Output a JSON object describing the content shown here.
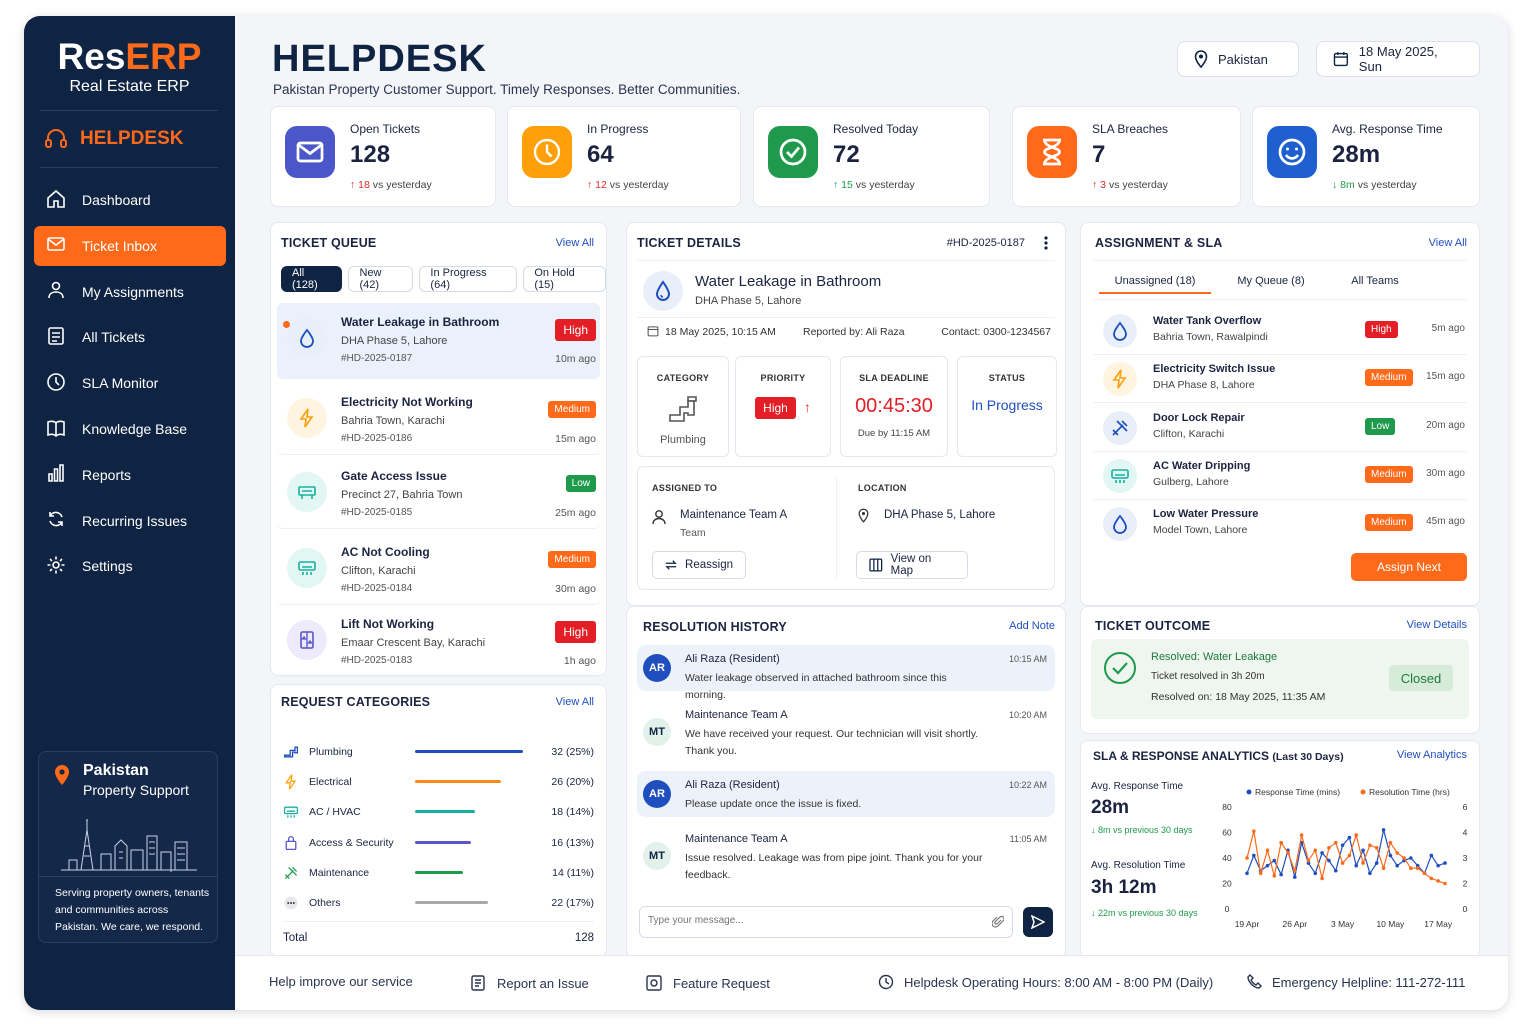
{
  "brand": {
    "name_a": "Res",
    "name_b": "ERP",
    "tagline": "Real Estate ERP"
  },
  "sidebar": {
    "section": "HELPDESK",
    "items": [
      {
        "label": "Dashboard",
        "icon": "home-icon"
      },
      {
        "label": "Ticket Inbox",
        "icon": "inbox-icon"
      },
      {
        "label": "My Assignments",
        "icon": "user-icon"
      },
      {
        "label": "All Tickets",
        "icon": "tickets-icon"
      },
      {
        "label": "SLA Monitor",
        "icon": "clock-icon"
      },
      {
        "label": "Knowledge Base",
        "icon": "book-icon"
      },
      {
        "label": "Reports",
        "icon": "bar-chart-icon"
      },
      {
        "label": "Recurring Issues",
        "icon": "refresh-icon"
      },
      {
        "label": "Settings",
        "icon": "gear-icon"
      }
    ],
    "active_index": 1,
    "promo": {
      "title": "Pakistan",
      "subtitle": "Property Support",
      "desc": "Serving property owners, tenants and communities across Pakistan. We care, we respond."
    }
  },
  "header": {
    "title": "HELPDESK",
    "subtitle": "Pakistan Property Customer Support. Timely Responses. Better Communities.",
    "location": "Pakistan",
    "date": "18 May 2025, Sun"
  },
  "stats": [
    {
      "label": "Open Tickets",
      "value": "128",
      "delta": "18",
      "suffix": "vs yesterday",
      "dir": "up",
      "color": "#4b57c9",
      "icon": "mail-icon"
    },
    {
      "label": "In Progress",
      "value": "64",
      "delta": "12",
      "suffix": "vs yesterday",
      "dir": "up",
      "color": "#ff9f0a",
      "icon": "clock-icon"
    },
    {
      "label": "Resolved Today",
      "value": "72",
      "delta": "15",
      "suffix": "vs yesterday",
      "dir": "up-green",
      "color": "#1f9a4d",
      "icon": "check-icon"
    },
    {
      "label": "SLA Breaches",
      "value": "7",
      "delta": "3",
      "suffix": "vs yesterday",
      "dir": "up",
      "color": "#ff6a1a",
      "icon": "hourglass-icon"
    },
    {
      "label": "Avg. Response Time",
      "value": "28m",
      "delta": "8m",
      "suffix": "vs yesterday",
      "dir": "down",
      "color": "#1f5fd0",
      "icon": "smile-icon"
    }
  ],
  "queue": {
    "title": "TICKET QUEUE",
    "view_all": "View All",
    "tabs": [
      "All (128)",
      "New (42)",
      "In Progress (64)",
      "On Hold (15)"
    ],
    "items": [
      {
        "name": "Water Leakage in Bathroom",
        "loc": "DHA Phase 5, Lahore",
        "id": "#HD-2025-0187",
        "priority": "High",
        "time": "10m ago",
        "icon": "water-drop-icon"
      },
      {
        "name": "Electricity Not Working",
        "loc": "Bahria Town, Karachi",
        "id": "#HD-2025-0186",
        "priority": "Medium",
        "time": "15m ago",
        "icon": "lightning-icon"
      },
      {
        "name": "Gate Access Issue",
        "loc": "Precinct 27, Bahria Town",
        "id": "#HD-2025-0185",
        "priority": "Low",
        "time": "25m ago",
        "icon": "gate-icon"
      },
      {
        "name": "AC Not Cooling",
        "loc": "Clifton, Karachi",
        "id": "#HD-2025-0184",
        "priority": "Medium",
        "time": "30m ago",
        "icon": "ac-icon"
      },
      {
        "name": "Lift Not Working",
        "loc": "Emaar Crescent Bay, Karachi",
        "id": "#HD-2025-0183",
        "priority": "High",
        "time": "1h ago",
        "icon": "lift-icon"
      }
    ]
  },
  "categories": {
    "title": "REQUEST CATEGORIES",
    "view_all": "View All",
    "items": [
      {
        "name": "Plumbing",
        "value": "32 (25%)",
        "fraction": 0.25,
        "color": "#1f4fbf",
        "icon": "pipe-icon"
      },
      {
        "name": "Electrical",
        "value": "26 (20%)",
        "fraction": 0.2,
        "color": "#ff8a1a",
        "icon": "lightning-icon"
      },
      {
        "name": "AC / HVAC",
        "value": "18 (14%)",
        "fraction": 0.14,
        "color": "#17b0a0",
        "icon": "ac-icon"
      },
      {
        "name": "Access & Security",
        "value": "16 (13%)",
        "fraction": 0.13,
        "color": "#5a55c8",
        "icon": "lock-icon"
      },
      {
        "name": "Maintenance",
        "value": "14 (11%)",
        "fraction": 0.11,
        "color": "#1f9a4d",
        "icon": "tools-icon"
      },
      {
        "name": "Others",
        "value": "22 (17%)",
        "fraction": 0.17,
        "color": "#aaaaaa",
        "icon": "more-icon"
      }
    ],
    "total_label": "Total",
    "total_value": "128"
  },
  "details": {
    "title": "TICKET DETAILS",
    "id": "#HD-2025-0187",
    "name": "Water Leakage in Bathroom",
    "loc": "DHA Phase 5, Lahore",
    "date": "18 May 2025, 10:15 AM",
    "reported": "Reported by: Ali Raza",
    "contact": "Contact: 0300-1234567",
    "category_label": "CATEGORY",
    "category": "Plumbing",
    "priority_label": "PRIORITY",
    "priority": "High",
    "sla_label": "SLA DEADLINE",
    "sla": "00:45:30",
    "due": "Due by 11:15 AM",
    "status_label": "STATUS",
    "status": "In Progress",
    "assigned_label": "ASSIGNED TO",
    "assigned": "Maintenance Team A",
    "assigned_sub": "Team",
    "location_label": "LOCATION",
    "location": "DHA Phase 5, Lahore",
    "reassign": "Reassign",
    "view_map": "View on Map"
  },
  "history": {
    "title": "RESOLUTION HISTORY",
    "add": "Add Note",
    "placeholder": "Type your message...",
    "items": [
      {
        "av": "AR",
        "who": "Ali Raza (Resident)",
        "msg": "Water leakage observed in attached bathroom since this morning.",
        "time": "10:15 AM"
      },
      {
        "av": "MT",
        "who": "Maintenance Team A",
        "msg": "We have received your request. Our technician will visit shortly. Thank you.",
        "time": "10:20 AM"
      },
      {
        "av": "AR",
        "who": "Ali Raza (Resident)",
        "msg": "Please update once the issue is fixed.",
        "time": "10:22 AM"
      },
      {
        "av": "MT",
        "who": "Maintenance Team A",
        "msg": "Issue resolved. Leakage was from pipe joint. Thank you for your feedback.",
        "time": "11:05 AM"
      }
    ]
  },
  "assignment": {
    "title": "ASSIGNMENT & SLA",
    "view_all": "View All",
    "tabs": [
      "Unassigned (18)",
      "My Queue (8)",
      "All Teams"
    ],
    "items": [
      {
        "name": "Water Tank Overflow",
        "loc": "Bahria Town, Rawalpindi",
        "priority": "High",
        "time": "5m ago",
        "icon": "water-drop-icon"
      },
      {
        "name": "Electricity Switch Issue",
        "loc": "DHA Phase 8, Lahore",
        "priority": "Medium",
        "time": "15m ago",
        "icon": "lightning-icon"
      },
      {
        "name": "Door Lock Repair",
        "loc": "Clifton, Karachi",
        "priority": "Low",
        "time": "20m ago",
        "icon": "tools-icon"
      },
      {
        "name": "AC Water Dripping",
        "loc": "Gulberg, Lahore",
        "priority": "Medium",
        "time": "30m ago",
        "icon": "ac-icon"
      },
      {
        "name": "Low Water Pressure",
        "loc": "Model Town, Lahore",
        "priority": "Medium",
        "time": "45m ago",
        "icon": "water-drop-icon"
      }
    ],
    "assign_next": "Assign Next"
  },
  "outcome": {
    "title": "TICKET OUTCOME",
    "view": "View Details",
    "headline": "Resolved: Water Leakage",
    "line1": "Ticket resolved in 3h 20m",
    "line2": "Resolved on: 18 May 2025, 11:35 AM",
    "status": "Closed"
  },
  "analytics": {
    "title": "SLA & RESPONSE ANALYTICS",
    "period": "(Last 30 Days)",
    "view": "View Analytics",
    "resp_label": "Avg. Response Time",
    "resp_value": "28m",
    "resp_change": "8m vs previous 30 days",
    "res_label": "Avg. Resolution Time",
    "res_value": "3h 12m",
    "res_change": "22m vs previous 30 days"
  },
  "chart_data": {
    "type": "line",
    "x": [
      "19 Apr",
      "20 Apr",
      "21 Apr",
      "22 Apr",
      "23 Apr",
      "24 Apr",
      "25 Apr",
      "26 Apr",
      "27 Apr",
      "28 Apr",
      "29 Apr",
      "30 Apr",
      "1 May",
      "2 May",
      "3 May",
      "4 May",
      "5 May",
      "6 May",
      "7 May",
      "8 May",
      "9 May",
      "10 May",
      "11 May",
      "12 May",
      "13 May",
      "14 May",
      "15 May",
      "16 May",
      "17 May",
      "18 May"
    ],
    "xticks": [
      "19 Apr",
      "26 Apr",
      "3 May",
      "10 May",
      "17 May"
    ],
    "series": [
      {
        "name": "Response Time (mins)",
        "axis": "left",
        "color": "#1f4fbf",
        "values": [
          28,
          42,
          30,
          34,
          38,
          27,
          46,
          25,
          52,
          36,
          28,
          44,
          38,
          30,
          50,
          56,
          34,
          46,
          28,
          36,
          62,
          42,
          34,
          38,
          40,
          34,
          28,
          42,
          34,
          36
        ]
      },
      {
        "name": "Resolution Time (hrs)",
        "axis": "right",
        "color": "#ff6a1a",
        "values": [
          3.0,
          4.1,
          2.4,
          3.3,
          2.3,
          3.6,
          3.2,
          2.5,
          3.9,
          2.9,
          3.3,
          2.2,
          3.4,
          3.6,
          2.8,
          3.1,
          3.9,
          2.8,
          3.5,
          3.4,
          2.6,
          3.6,
          3.2,
          3.0,
          2.6,
          2.6,
          2.4,
          2.2,
          2.1,
          2.0
        ]
      }
    ],
    "ylim_left": [
      0,
      80
    ],
    "yticks_left": [
      "80",
      "60",
      "40",
      "20",
      "0"
    ],
    "ylim_right": [
      0,
      6
    ],
    "yticks_right": [
      "6",
      "4",
      "3",
      "2",
      "0"
    ]
  },
  "footer": {
    "help": "Help improve our service",
    "report": "Report an Issue",
    "feature": "Feature Request",
    "hours": "Helpdesk Operating Hours: 8:00 AM - 8:00 PM (Daily)",
    "helpline": "Emergency Helpline: 111-272-111"
  }
}
